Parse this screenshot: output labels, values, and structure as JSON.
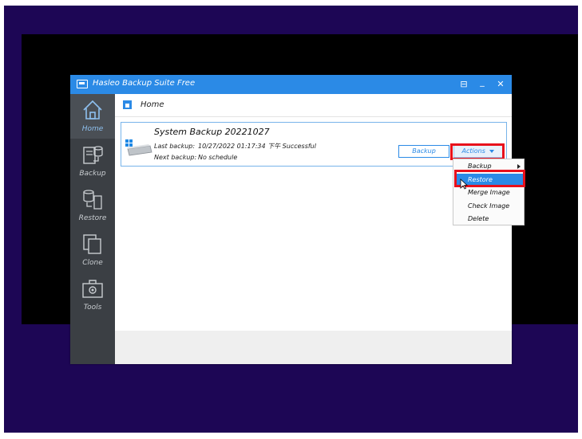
{
  "window": {
    "title": "Hasleo Backup Suite Free"
  },
  "titlebar": {
    "restore_glyph": "⊟",
    "minimize_glyph": "_",
    "close_glyph": "✕"
  },
  "sidebar": {
    "items": [
      {
        "label": "Home",
        "icon": "home-icon",
        "active": true
      },
      {
        "label": "Backup",
        "icon": "backup-icon"
      },
      {
        "label": "Restore",
        "icon": "restore-icon"
      },
      {
        "label": "Clone",
        "icon": "clone-icon"
      },
      {
        "label": "Tools",
        "icon": "tools-icon"
      }
    ]
  },
  "breadcrumb": {
    "label": "Home"
  },
  "backup_card": {
    "title": "System Backup 20221027",
    "last_backup_label": "Last backup:",
    "last_backup_value": "10/27/2022 01:17:34 下午 Successful",
    "next_backup_label": "Next backup:",
    "next_backup_value": "No schedule",
    "backup_button": "Backup",
    "actions_button": "Actions"
  },
  "actions_menu": {
    "items": [
      "Backup",
      "Restore",
      "Merge Image",
      "Check Image",
      "Delete"
    ],
    "selected": "Restore"
  },
  "colors": {
    "accent": "#2b8ae6",
    "highlight": "#e8101b",
    "desktop": "#1d0655",
    "sidebar": "#3b3f44"
  }
}
